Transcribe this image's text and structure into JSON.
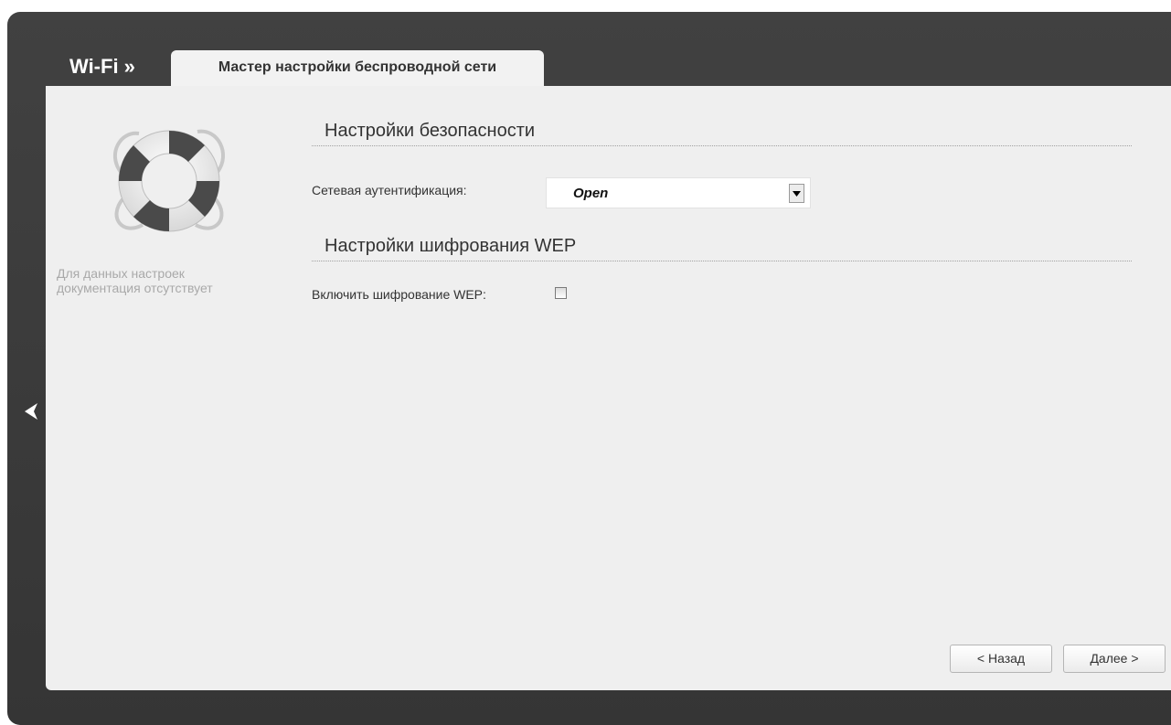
{
  "breadcrumb": "Wi-Fi »",
  "tab": {
    "label": "Мастер настройки беспроводной сети"
  },
  "sidebar": {
    "no_docs_text": "Для данных настроек документация отсутствует"
  },
  "security": {
    "title": "Настройки безопасности",
    "auth_label": "Сетевая аутентификация:",
    "auth_value": "Open"
  },
  "wep": {
    "title": "Настройки шифрования WEP",
    "enable_label": "Включить шифрование WEP:",
    "enabled": false
  },
  "buttons": {
    "back": "< Назад",
    "next": "Далее >"
  },
  "icons": {
    "nav_back": "chevron-left-icon",
    "help": "lifebuoy-icon",
    "dropdown": "triangle-down-icon"
  },
  "colors": {
    "frame": "#3b3b3b",
    "panel": "#efefef",
    "text": "#333333",
    "muted_text": "#a9a9a9"
  }
}
